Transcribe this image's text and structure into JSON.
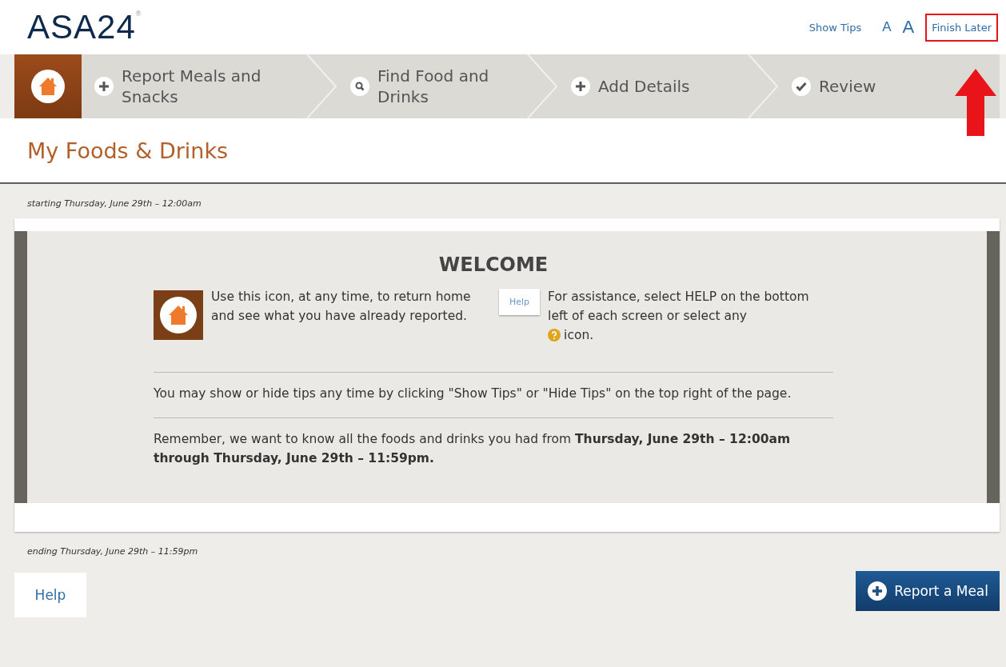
{
  "header": {
    "logo": "ASA24",
    "logo_mark": "®",
    "show_tips": "Show Tips",
    "font_small": "A",
    "font_large": "A",
    "finish_later": {
      "label": "Finish Later",
      "highlighted": true
    }
  },
  "steps": [
    {
      "kind": "home"
    },
    {
      "kind": "plus",
      "label": "Report Meals and Snacks"
    },
    {
      "kind": "search",
      "label": "Find Food and Drinks"
    },
    {
      "kind": "plus",
      "label": "Add Details"
    },
    {
      "kind": "check",
      "label": "Review"
    }
  ],
  "page_title": "My Foods & Drinks",
  "start_text": "starting Thursday, June 29th – 12:00am",
  "welcome": {
    "title": "WELCOME",
    "home_text": "Use this icon, at any time, to return home and see what you have already reported.",
    "help_label": "Help",
    "help_text_before": "For assistance, select HELP on the bottom left of each screen or select any",
    "help_text_after": "icon.",
    "paragraphs": [
      "You may show or hide tips any time by clicking \"Show Tips\" or \"Hide Tips\" on the top right of the page.",
      "Remember, we want to know all the foods and drinks you had from **Thursday, June 29th – 12:00am through Thursday, June 29th – 11:59pm.**"
    ]
  },
  "end_text": "ending Thursday, June 29th – 11:59pm",
  "footer": {
    "help": "Help",
    "report": "Report a Meal"
  }
}
